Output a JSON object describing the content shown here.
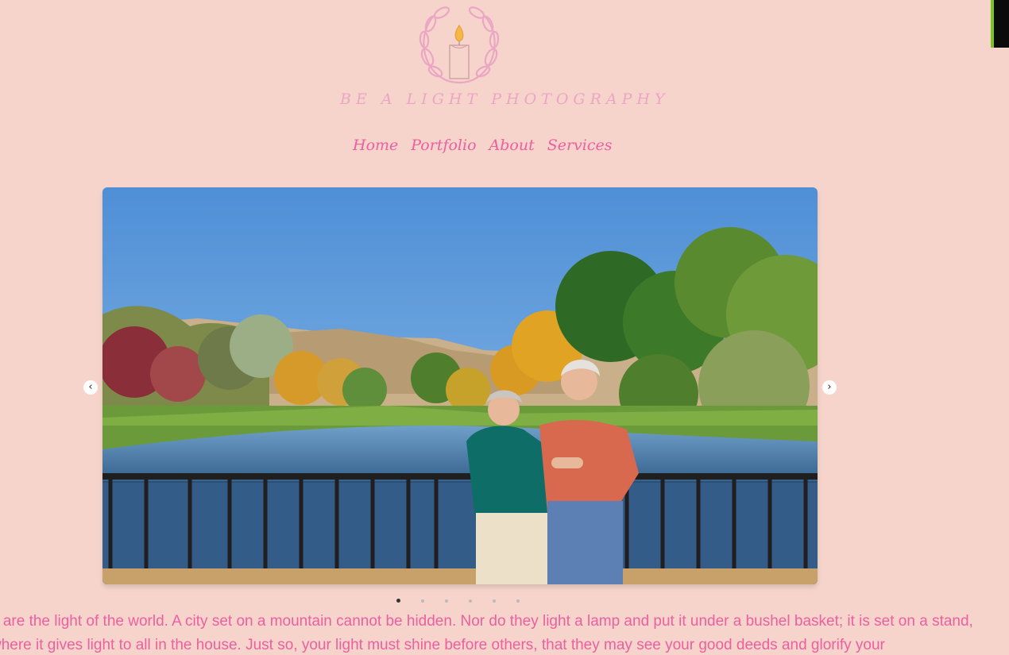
{
  "brand": {
    "name": "BE A LIGHT PHOTOGRAPHY",
    "logo_icon": "candle-wreath-icon",
    "color": "#eba6c3"
  },
  "nav": {
    "items": [
      {
        "label": "Home"
      },
      {
        "label": "Portfolio"
      },
      {
        "label": "About"
      },
      {
        "label": "Services"
      }
    ],
    "color": "#ec5fa0"
  },
  "slider": {
    "prev_icon": "chevron-left-icon",
    "next_icon": "chevron-right-icon",
    "slide_count": 6,
    "active_slide": 1
  },
  "quote": {
    "text": "u are the light of the world. A city set on a mountain cannot be hidden. Nor do they light a lamp and put it under a bushel basket; it is set on a stand, where it gives light to all in the house. Just so, your light must shine before others, that they may see your good deeds and glorify your"
  },
  "colors": {
    "background": "#f6d4cb",
    "accent": "#ec5fa0"
  }
}
